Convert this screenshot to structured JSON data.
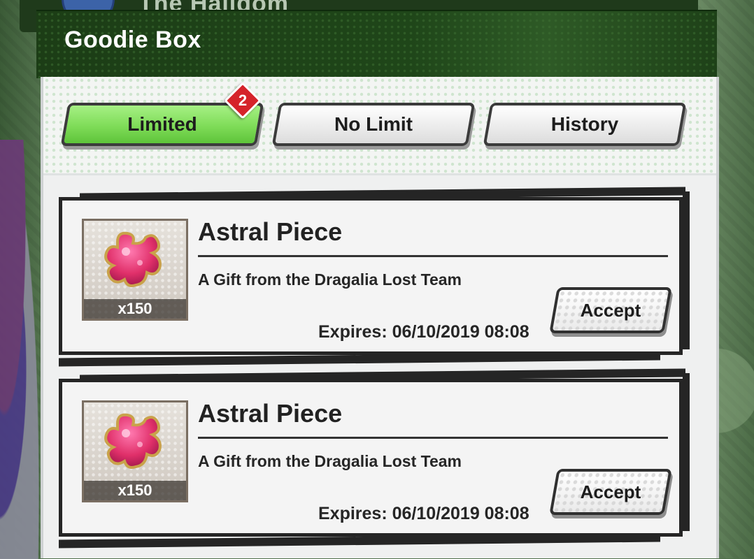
{
  "background": {
    "banner_text": "The Halidom"
  },
  "dialog": {
    "title": "Goodie Box"
  },
  "tabs": [
    {
      "label": "Limited",
      "active": true,
      "badge": "2"
    },
    {
      "label": "No Limit",
      "active": false
    },
    {
      "label": "History",
      "active": false
    }
  ],
  "items": [
    {
      "name": "Astral Piece",
      "quantity": "x150",
      "sender": "A Gift from the Dragalia Lost Team",
      "expires": "Expires: 06/10/2019 08:08",
      "action_label": "Accept",
      "icon": "astral-piece-icon"
    },
    {
      "name": "Astral Piece",
      "quantity": "x150",
      "sender": "A Gift from the Dragalia Lost Team",
      "expires": "Expires: 06/10/2019 08:08",
      "action_label": "Accept",
      "icon": "astral-piece-icon"
    }
  ],
  "colors": {
    "header_green": "#1f4619",
    "active_tab_green": "#7fdc58",
    "badge_red": "#d5232a",
    "piece_pink": "#e0306a"
  }
}
